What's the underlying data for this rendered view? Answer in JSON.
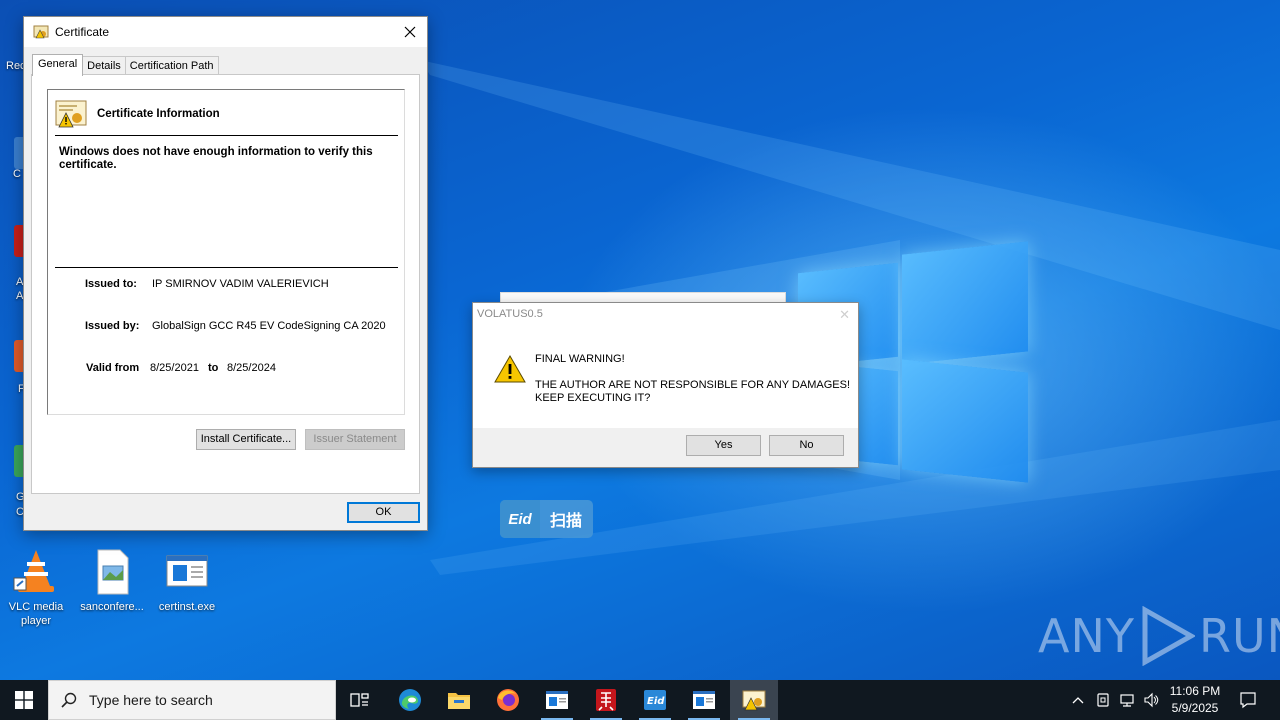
{
  "desktop": {
    "icons": [
      {
        "label": "VLC media player"
      },
      {
        "label": "sanconfere..."
      },
      {
        "label": "certinst.exe"
      }
    ],
    "partial_labels": [
      "Rec",
      "C",
      "A",
      "A",
      "F",
      "G",
      "C"
    ],
    "watermark": "ANY RUN"
  },
  "certificate_dialog": {
    "title": "Certificate",
    "tabs": [
      "General",
      "Details",
      "Certification Path"
    ],
    "info_heading": "Certificate Information",
    "warning": "Windows does not have enough information to verify this certificate.",
    "issued_to_label": "Issued to:",
    "issued_to_value": "IP SMIRNOV VADIM VALERIEVICH",
    "issued_by_label": "Issued by:",
    "issued_by_value": "GlobalSign GCC R45 EV CodeSigning CA 2020",
    "valid_from_label": "Valid from",
    "valid_from_value": "8/25/2021",
    "valid_to_label": "to",
    "valid_to_value": "8/25/2024",
    "install_button": "Install Certificate...",
    "issuer_statement_button": "Issuer Statement",
    "ok_button": "OK"
  },
  "volatus_dialog": {
    "title": "VOLATUS0.5",
    "line1": "FINAL WARNING!",
    "line2": "THE AUTHOR ARE NOT RESPONSIBLE FOR ANY DAMAGES!",
    "line3": "KEEP EXECUTING IT?",
    "yes_button": "Yes",
    "no_button": "No",
    "close_glyph": "✕"
  },
  "eid_widget": {
    "logo": "Eid",
    "label": "扫描"
  },
  "taskbar": {
    "search_placeholder": "Type here to search",
    "time": "11:06 PM",
    "date": "5/9/2025"
  },
  "colors": {
    "accent": "#0078d7",
    "taskbar": "#101820"
  }
}
